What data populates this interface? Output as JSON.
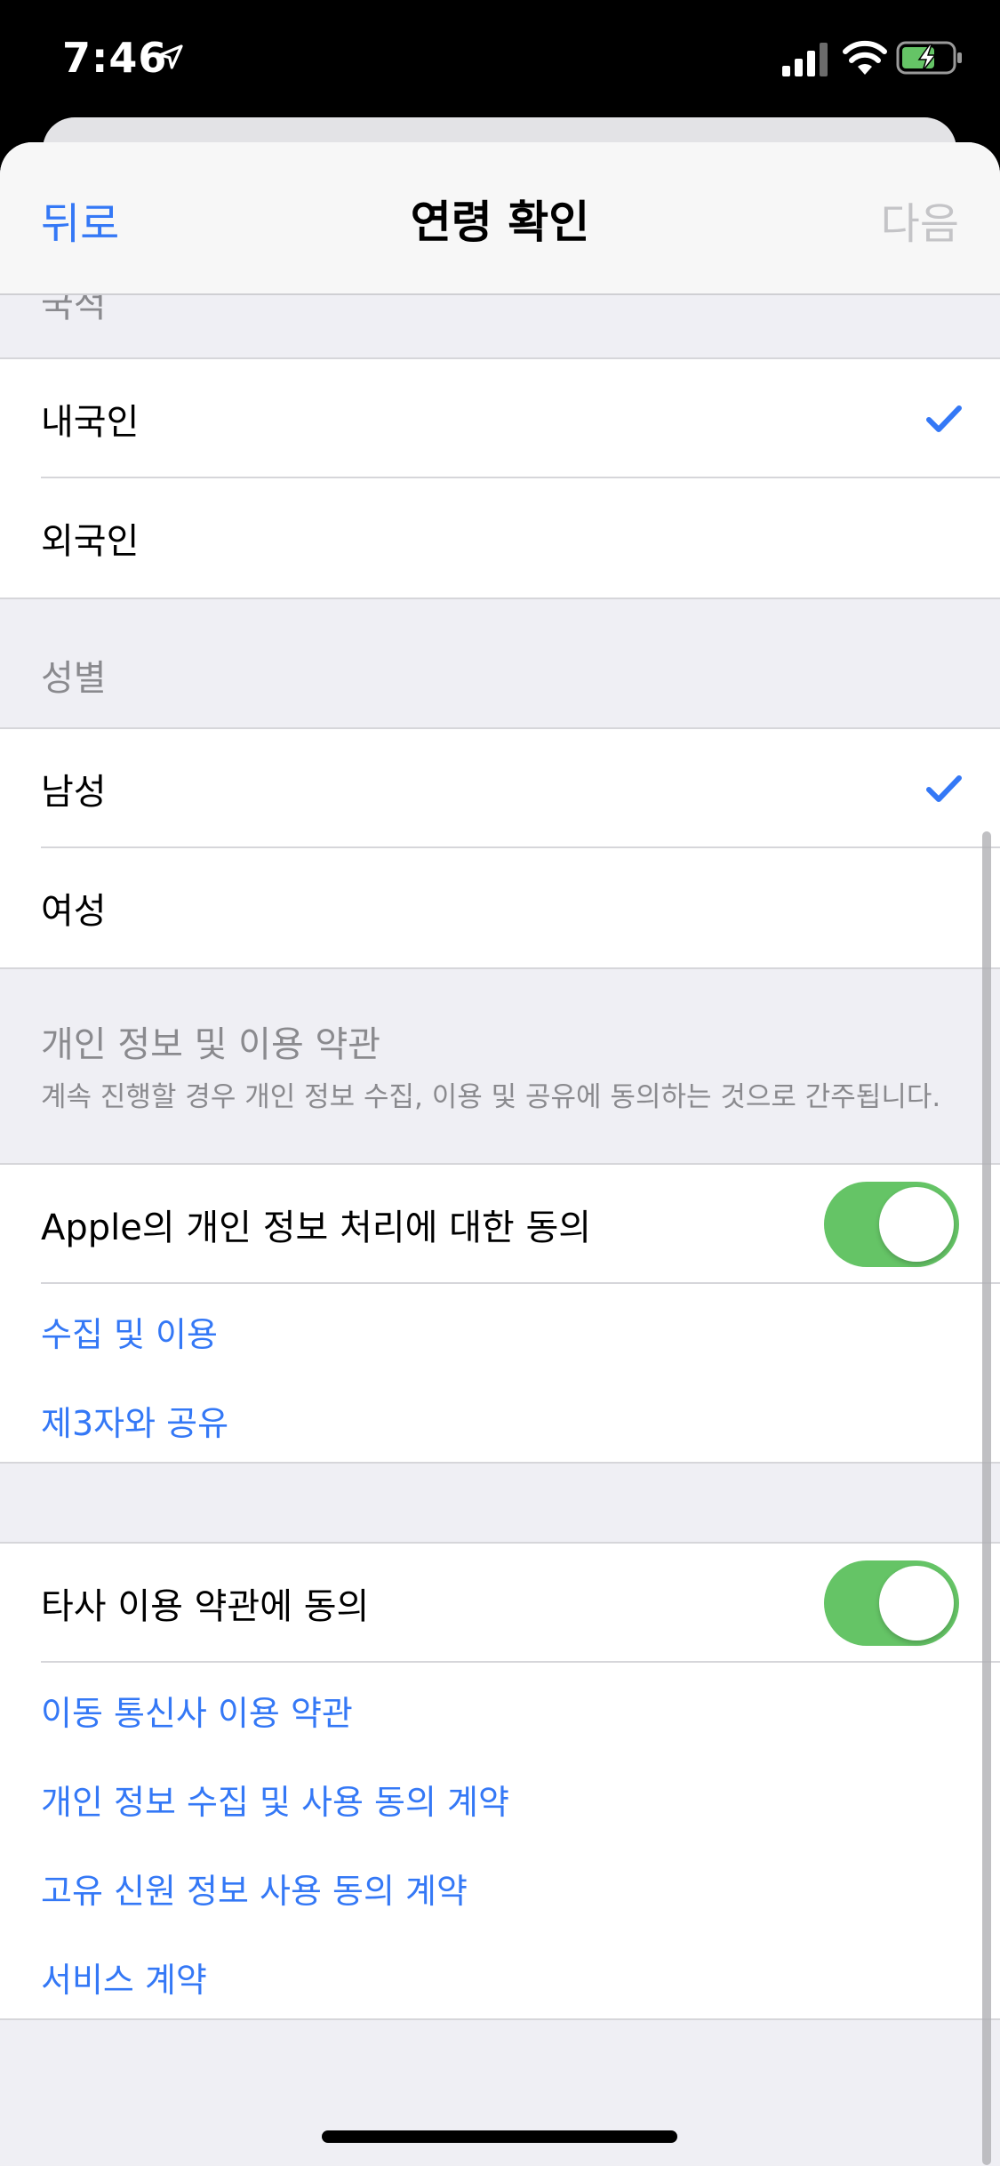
{
  "status_bar": {
    "time": "7:46",
    "icons": [
      "location-arrow-icon",
      "signal-icon",
      "wifi-icon",
      "battery-charging-icon"
    ]
  },
  "nav": {
    "back_label": "뒤로",
    "title": "연령 확인",
    "next_label": "다음"
  },
  "partial_header": "국적",
  "nationality": {
    "options": [
      {
        "label": "내국인",
        "selected": true
      },
      {
        "label": "외국인",
        "selected": false
      }
    ]
  },
  "gender": {
    "header": "성별",
    "options": [
      {
        "label": "남성",
        "selected": true
      },
      {
        "label": "여성",
        "selected": false
      }
    ]
  },
  "privacy": {
    "header": "개인 정보 및 이용 약관",
    "subtitle": "계속 진행할 경우 개인 정보 수집, 이용 및 공유에 동의하는 것으로 간주됩니다.",
    "apple_consent": {
      "label": "Apple의 개인 정보 처리에 대한 동의",
      "on": true
    },
    "links": [
      "수집 및 이용",
      "제3자와 공유"
    ]
  },
  "third_party": {
    "consent": {
      "label": "타사 이용 약관에 동의",
      "on": true
    },
    "links": [
      "이동 통신사 이용 약관",
      "개인 정보 수집 및 사용 동의 계약",
      "고유 신원 정보 사용 동의 계약",
      "서비스 계약"
    ]
  },
  "colors": {
    "accent": "#3478f6",
    "toggle_on": "#65c466",
    "disabled": "#c4c4c7",
    "grouped_background": "#efeff4"
  }
}
